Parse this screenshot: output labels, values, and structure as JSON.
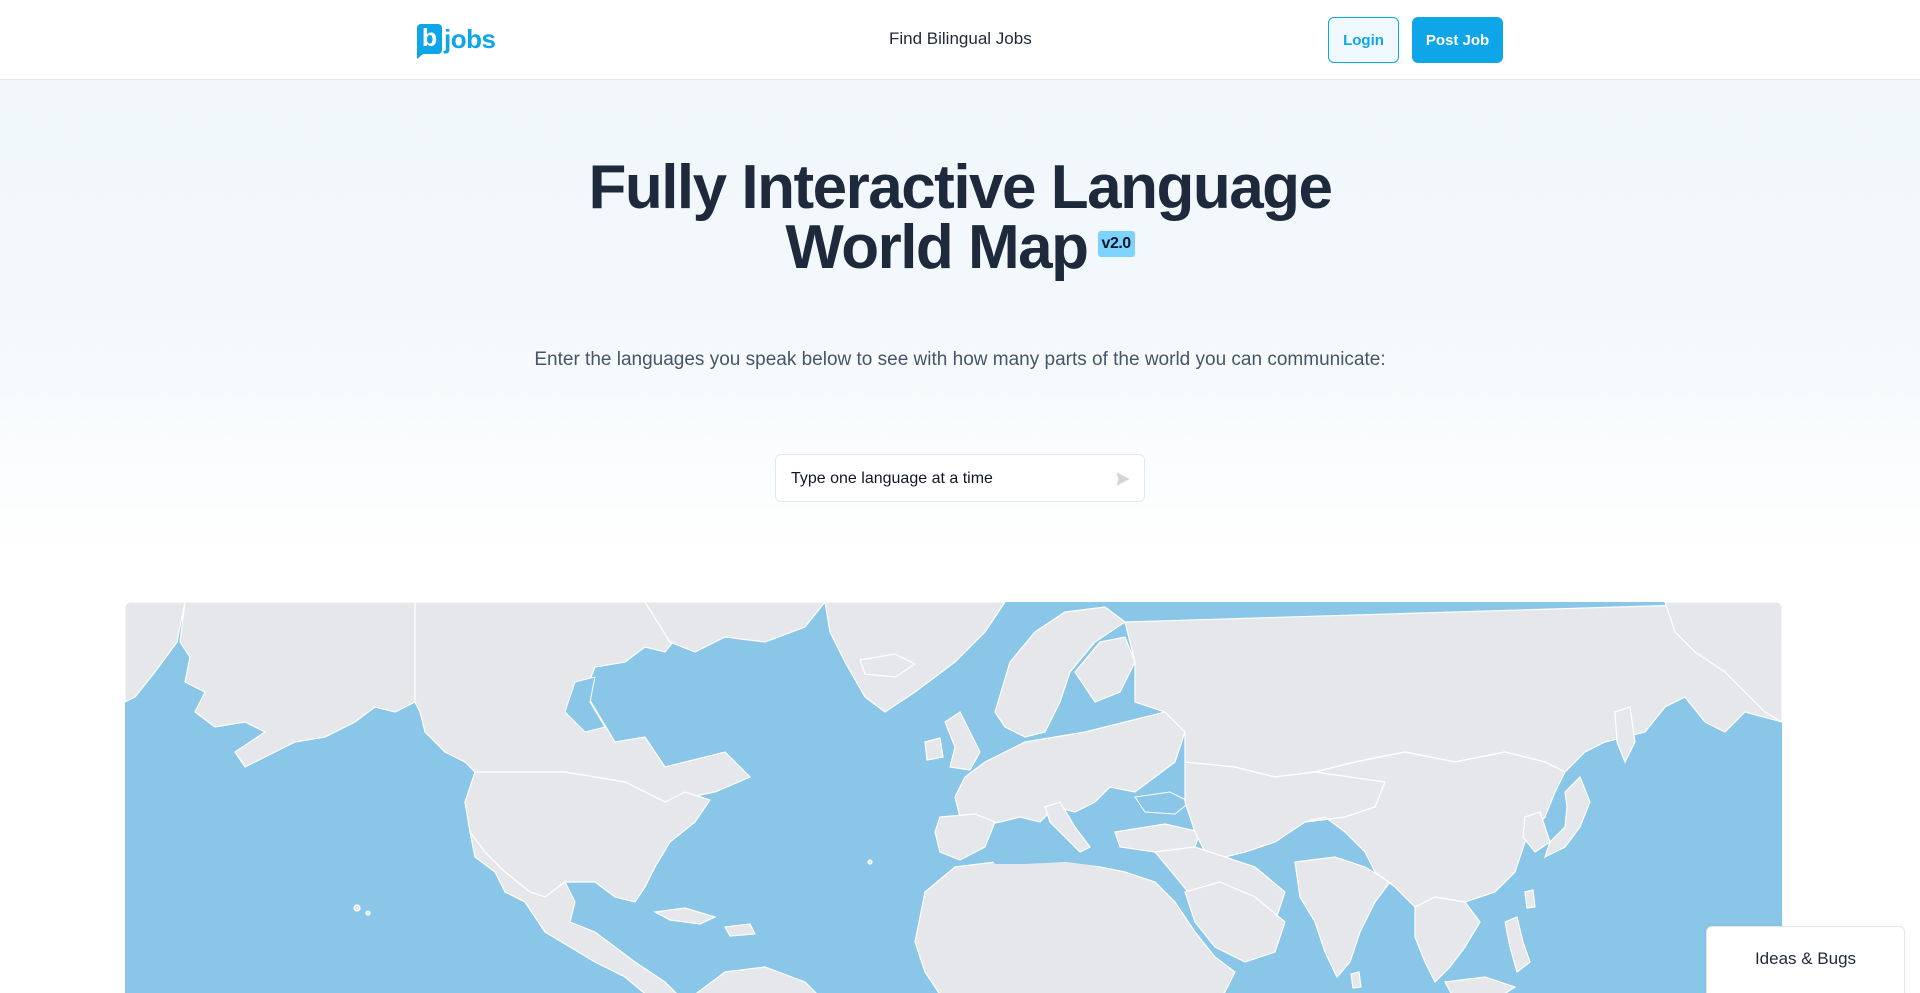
{
  "header": {
    "logo_letter": "b",
    "logo_text": "jobs",
    "nav_link": "Find Bilingual Jobs",
    "login_label": "Login",
    "post_job_label": "Post Job"
  },
  "hero": {
    "title_line1": "Fully Interactive Language",
    "title_line2": "World Map",
    "version": "v2.0",
    "subtitle": "Enter the languages you speak below to see with how many parts of the world you can communicate:"
  },
  "search": {
    "placeholder": "Type one language at a time",
    "submit_icon": "send-icon"
  },
  "map": {
    "ocean_color": "#89c6e8",
    "land_color": "#e5e7eb",
    "border_color": "#ffffff"
  },
  "feedback": {
    "label": "Ideas & Bugs"
  },
  "colors": {
    "accent": "#0ea5e9",
    "badge": "#7dd3fc",
    "title": "#1e293b"
  }
}
